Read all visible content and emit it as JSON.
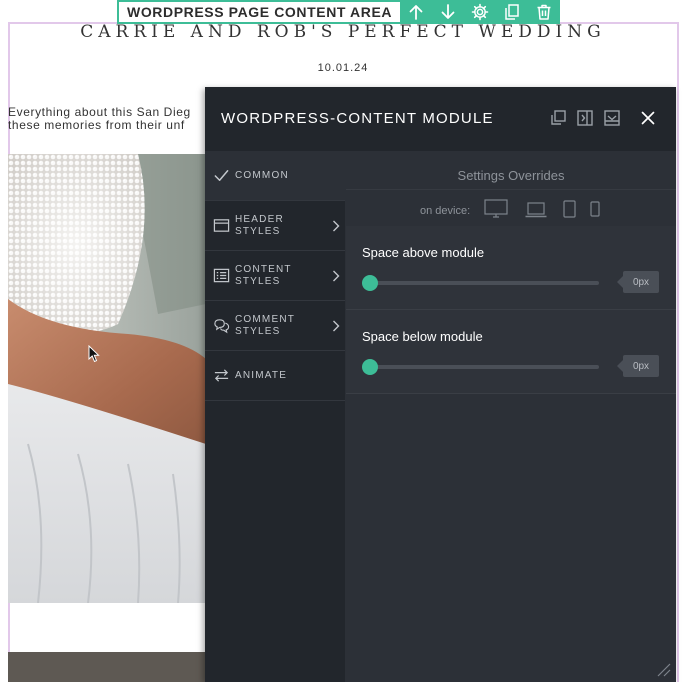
{
  "page": {
    "title": "CARRIE AND ROB'S PERFECT WEDDING",
    "date": "10.01.24",
    "intro_line1": "Everything about this San Dieg",
    "intro_line2": "these memories from their unf"
  },
  "toolbar": {
    "label": "WORDPRESS PAGE CONTENT AREA",
    "buttons": [
      {
        "name": "arrow-up-icon"
      },
      {
        "name": "arrow-down-icon"
      },
      {
        "name": "gear-icon"
      },
      {
        "name": "duplicate-icon"
      },
      {
        "name": "trash-icon"
      }
    ],
    "accent_color": "#3dbd97"
  },
  "panel": {
    "title": "WORDPRESS-CONTENT MODULE",
    "header_icons": [
      "copy-icon",
      "dock-right-icon",
      "save-icon",
      "close-icon"
    ],
    "nav": [
      {
        "label": "COMMON",
        "icon": "checkmark-icon",
        "active": true,
        "chevron": false
      },
      {
        "label": "HEADER STYLES",
        "icon": "window-icon",
        "active": false,
        "chevron": true
      },
      {
        "label": "CONTENT STYLES",
        "icon": "list-icon",
        "active": false,
        "chevron": true
      },
      {
        "label": "COMMENT STYLES",
        "icon": "chat-bubbles-icon",
        "active": false,
        "chevron": true
      },
      {
        "label": "ANIMATE",
        "icon": "swap-arrows-icon",
        "active": false,
        "chevron": false
      }
    ],
    "overrides_title": "Settings Overrides",
    "device_label": "on device:",
    "devices": [
      "desktop-icon",
      "laptop-icon",
      "tablet-icon",
      "phone-icon"
    ],
    "settings": [
      {
        "label": "Space above module",
        "value": "0px",
        "slider_fraction": 0
      },
      {
        "label": "Space below module",
        "value": "0px",
        "slider_fraction": 0
      }
    ],
    "colors": {
      "panel_bg": "#2c3037",
      "nav_bg": "#22262c"
    }
  }
}
